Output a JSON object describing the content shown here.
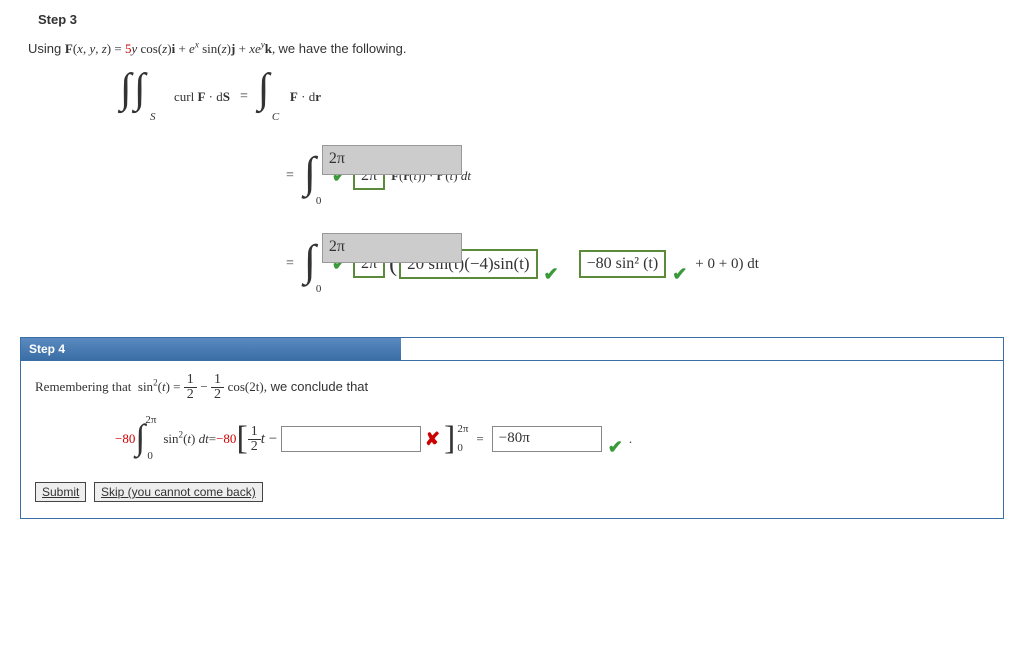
{
  "step3": {
    "heading": "Step 3",
    "prompt_pre": "Using ",
    "F_eq": "F(x, y, z) = 5y cos(z)i + eˣ sin(z)j + xeʸk,",
    "prompt_post": " we have the following.",
    "lhs_curl": "curl F · dS",
    "rhs_line": "F · dr",
    "sub_S": "S",
    "sub_C": "C",
    "int_lower": "0",
    "box1_upper": "2π",
    "ans1": "2π",
    "tail1": "F(r(t)) · r′(t) dt",
    "box2_upper": "2π",
    "ans2a": "2π",
    "ans2b": "20 sin(t)(−4)sin(t)",
    "ans2c": "−80 sin² (t)",
    "tail2": "+ 0 + 0) dt"
  },
  "step4": {
    "heading": "Step 4",
    "prompt_pre": "Remembering that  sin²(t) = ",
    "frac1n": "1",
    "frac1d": "2",
    "minus": " − ",
    "frac2n": "1",
    "frac2d": "2",
    "cos2t": " cos(2t),",
    "prompt_post": "  we conclude that",
    "coef": "−80",
    "upper": "2π",
    "lower": "0",
    "integrand": "sin²(t) dt",
    "eq": " = ",
    "coef2": "−80",
    "half_t_n": "1",
    "half_t_d": "2",
    "t_after": "t − ",
    "lim_top": "2π",
    "lim_bot": "0",
    "final_answer": "−80π",
    "period": "."
  },
  "buttons": {
    "submit": "Submit",
    "skip": "Skip (you cannot come back)"
  }
}
